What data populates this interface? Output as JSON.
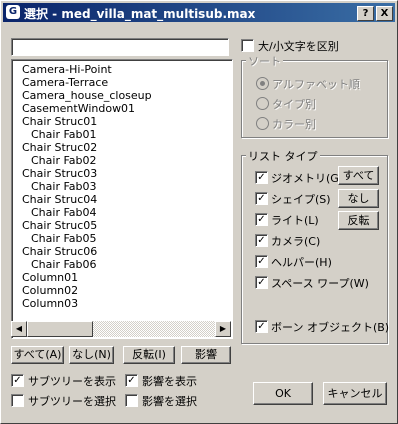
{
  "window": {
    "title": "選択 - med_villa_mat_multisub.max",
    "help_label": "?",
    "close_label": "X"
  },
  "search": {
    "value": ""
  },
  "list_items": [
    {
      "label": "Camera-Hi-Point",
      "indent": false
    },
    {
      "label": "Camera-Terrace",
      "indent": false
    },
    {
      "label": "Camera_house_closeup",
      "indent": false
    },
    {
      "label": "CasementWindow01",
      "indent": false
    },
    {
      "label": "Chair Struc01",
      "indent": false
    },
    {
      "label": "Chair Fab01",
      "indent": true
    },
    {
      "label": "Chair Struc02",
      "indent": false
    },
    {
      "label": "Chair Fab02",
      "indent": true
    },
    {
      "label": "Chair Struc03",
      "indent": false
    },
    {
      "label": "Chair Fab03",
      "indent": true
    },
    {
      "label": "Chair Struc04",
      "indent": false
    },
    {
      "label": "Chair Fab04",
      "indent": true
    },
    {
      "label": "Chair Struc05",
      "indent": false
    },
    {
      "label": "Chair Fab05",
      "indent": true
    },
    {
      "label": "Chair Struc06",
      "indent": false
    },
    {
      "label": "Chair Fab06",
      "indent": true
    },
    {
      "label": "Column01",
      "indent": false
    },
    {
      "label": "Column02",
      "indent": false
    },
    {
      "label": "Column03",
      "indent": false
    }
  ],
  "bottom_buttons": {
    "all": "すべて(A)",
    "none": "なし(N)",
    "invert": "反転(I)",
    "influence": "影響"
  },
  "bottom_checks": {
    "show_subtree": {
      "label": "サブツリーを表示",
      "checked": true
    },
    "select_subtree": {
      "label": "サブツリーを選択",
      "checked": false
    },
    "show_influence": {
      "label": "影響を表示",
      "checked": true
    },
    "select_influence": {
      "label": "影響を選択",
      "checked": false
    }
  },
  "case_sensitive": {
    "label": "大/小文字を区別",
    "checked": false
  },
  "sort": {
    "label": "ソート",
    "options": [
      {
        "label": "アルファベット順",
        "selected": true
      },
      {
        "label": "タイプ別",
        "selected": false
      },
      {
        "label": "カラー別",
        "selected": false
      }
    ]
  },
  "list_types": {
    "label": "リスト タイプ",
    "items": [
      {
        "label": "ジオメトリ(G)",
        "checked": true
      },
      {
        "label": "シェイプ(S)",
        "checked": true
      },
      {
        "label": "ライト(L)",
        "checked": true
      },
      {
        "label": "カメラ(C)",
        "checked": true
      },
      {
        "label": "ヘルパー(H)",
        "checked": true
      },
      {
        "label": "スペース ワープ(W)",
        "checked": true
      }
    ],
    "bones": {
      "label": "ボーン オブジェクト(B)",
      "checked": true
    },
    "all_label": "すべて",
    "none_label": "なし",
    "invert_label": "反転"
  },
  "ok_label": "OK",
  "cancel_label": "キャンセル",
  "check_mark": "✓"
}
